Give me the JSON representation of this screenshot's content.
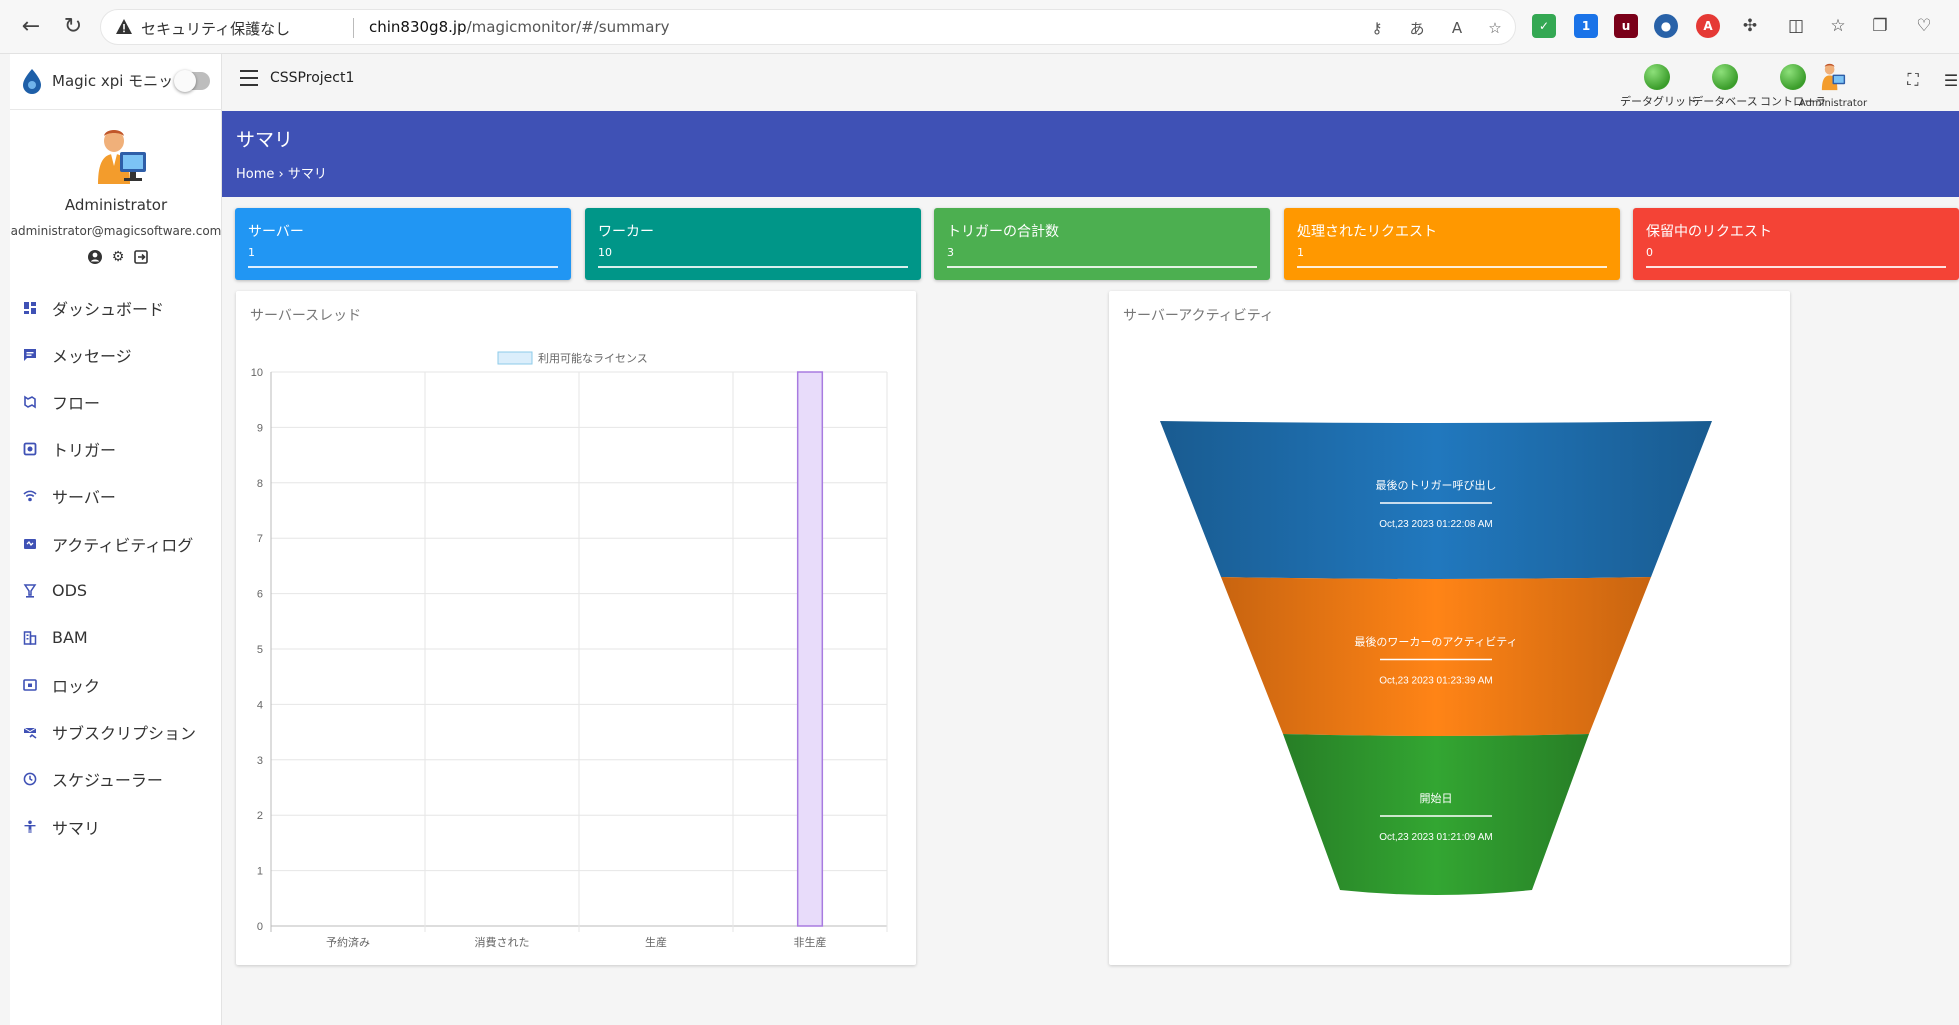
{
  "browser": {
    "security_label": "セキュリティ保護なし",
    "url_host": "chin830g8.jp",
    "url_path": "/magicmonitor/#/summary"
  },
  "sidebar": {
    "brand_title": "Magic xpi モニット",
    "profile": {
      "name": "Administrator",
      "email": "administrator@magicsoftware.com"
    },
    "items": [
      {
        "label": "ダッシュボード",
        "icon": "dashboard-icon"
      },
      {
        "label": "メッセージ",
        "icon": "message-icon"
      },
      {
        "label": "フロー",
        "icon": "flow-icon"
      },
      {
        "label": "トリガー",
        "icon": "trigger-icon"
      },
      {
        "label": "サーバー",
        "icon": "wifi-icon"
      },
      {
        "label": "アクティビティログ",
        "icon": "activity-log-icon"
      },
      {
        "label": "ODS",
        "icon": "ods-icon"
      },
      {
        "label": "BAM",
        "icon": "bam-icon"
      },
      {
        "label": "ロック",
        "icon": "lock-icon"
      },
      {
        "label": "サブスクリプション",
        "icon": "subscription-icon"
      },
      {
        "label": "スケジューラー",
        "icon": "clock-icon"
      },
      {
        "label": "サマリ",
        "icon": "summary-icon"
      }
    ]
  },
  "appbar": {
    "project_name": "CSSProject1",
    "status": [
      {
        "label": "データグリッド"
      },
      {
        "label": "データベース"
      },
      {
        "label": "コントローラ"
      }
    ],
    "admin_label": "Administrator"
  },
  "header": {
    "title": "サマリ",
    "breadcrumb_home": "Home",
    "breadcrumb_sep": "›",
    "breadcrumb_current": "サマリ"
  },
  "stats": [
    {
      "title": "サーバー",
      "value": "1",
      "color": "#2196f3"
    },
    {
      "title": "ワーカー",
      "value": "10",
      "color": "#009688"
    },
    {
      "title": "トリガーの合計数",
      "value": "3",
      "color": "#4caf50"
    },
    {
      "title": "処理されたリクエスト",
      "value": "1",
      "color": "#ff9800"
    },
    {
      "title": "保留中のリクエスト",
      "value": "0",
      "color": "#f44336"
    }
  ],
  "panels": {
    "threads_title": "サーバースレッド",
    "activity_title": "サーバーアクティビティ"
  },
  "chart_data": {
    "type": "bar",
    "categories": [
      "予約済み",
      "消費された",
      "生産",
      "非生産"
    ],
    "series": [
      {
        "name": "利用可能なライセンス",
        "values": [
          0,
          0,
          0,
          10
        ]
      }
    ],
    "ylim": [
      0,
      10
    ],
    "yticks": [
      0,
      1,
      2,
      3,
      4,
      5,
      6,
      7,
      8,
      9,
      10
    ],
    "grid": true,
    "legend": "top",
    "bar_fill": "#e8dcfa",
    "bar_stroke": "#a87be0"
  },
  "funnel": [
    {
      "label": "最後のトリガー呼び出し",
      "value": "Oct,23 2023 01:22:08 AM",
      "color": "#1f6fb0"
    },
    {
      "label": "最後のワーカーのアクティビティ",
      "value": "Oct,23 2023 01:23:39 AM",
      "color": "#f47a14"
    },
    {
      "label": "開始日",
      "value": "Oct,23 2023 01:21:09 AM",
      "color": "#2f9a2e"
    }
  ]
}
